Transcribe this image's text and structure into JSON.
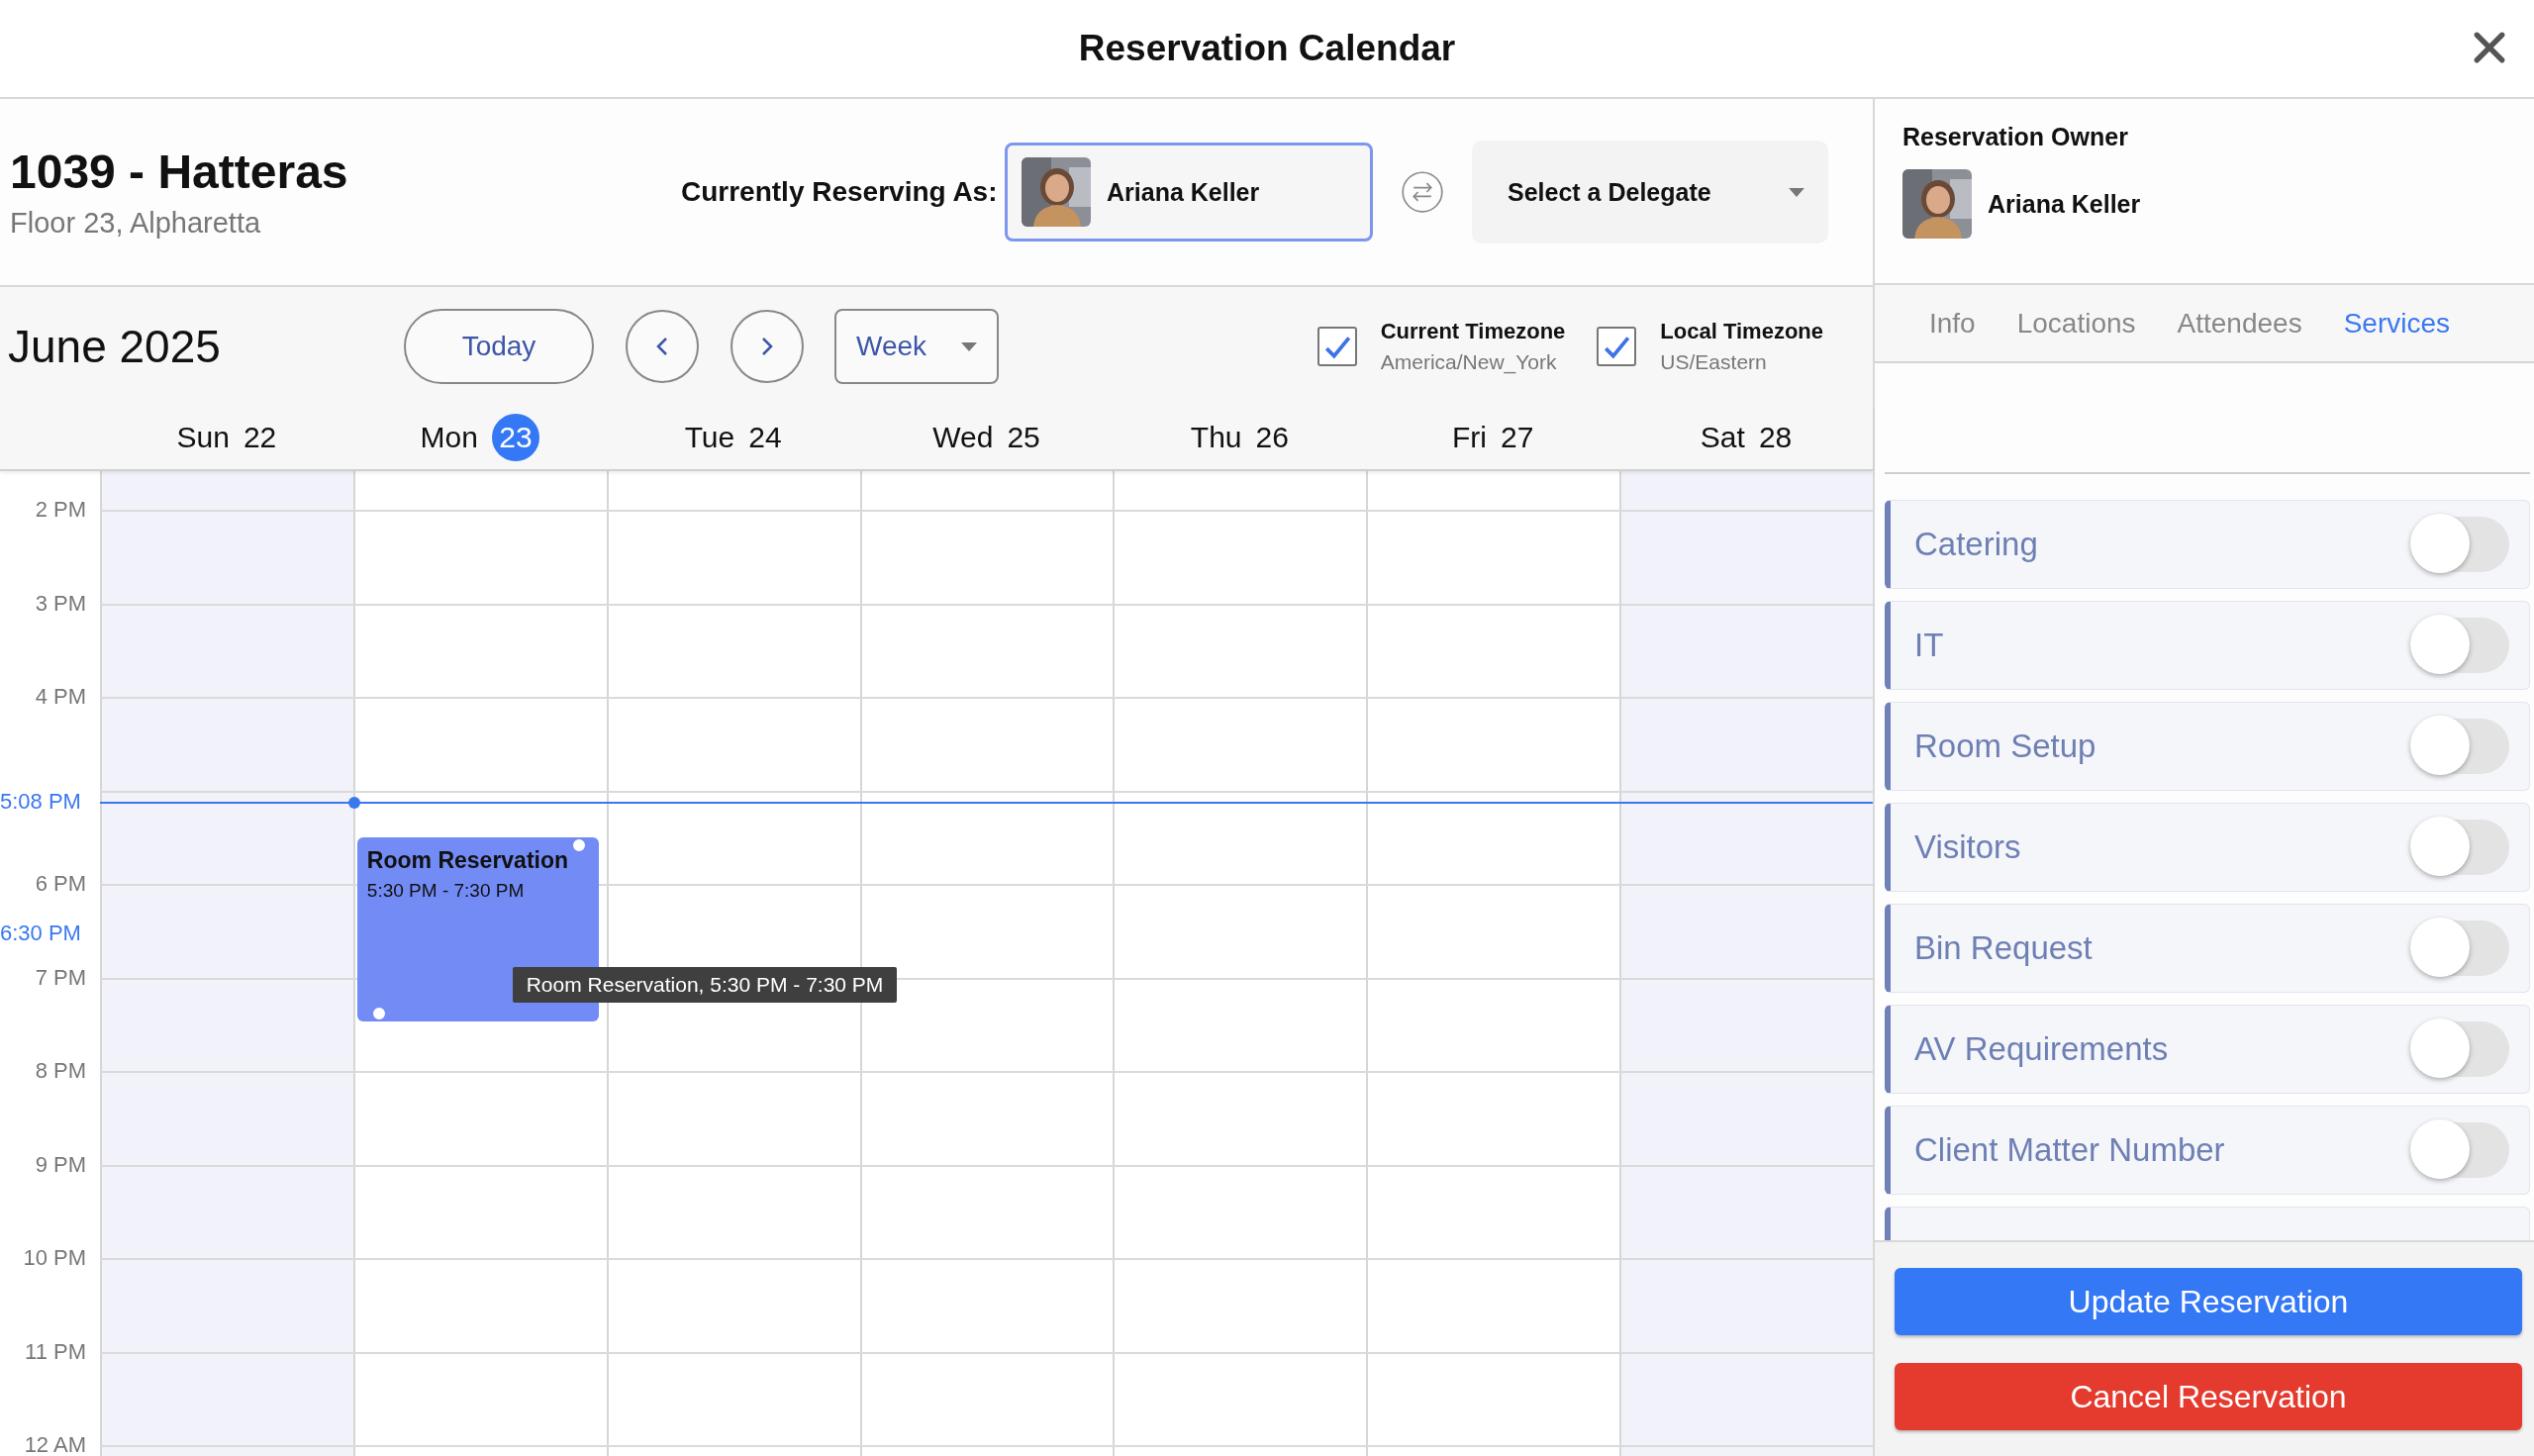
{
  "window": {
    "title": "Reservation Calendar"
  },
  "room": {
    "title": "1039 - Hatteras",
    "subtitle": "Floor 23, Alpharetta"
  },
  "reserving_as": {
    "label": "Currently Reserving As:",
    "name": "Ariana Keller"
  },
  "delegate": {
    "placeholder": "Select a Delegate"
  },
  "toolbar": {
    "month": "June 2025",
    "today": "Today",
    "view": "Week"
  },
  "timezones": [
    {
      "title": "Current Timezone",
      "zone": "America/New_York",
      "checked": true
    },
    {
      "title": "Local Timezone",
      "zone": "US/Eastern",
      "checked": true
    }
  ],
  "days": [
    {
      "name": "Sun",
      "date": "22",
      "today": false,
      "weekend": true
    },
    {
      "name": "Mon",
      "date": "23",
      "today": true,
      "weekend": false,
      "events": [
        {
          "title": "Room Reservation",
          "time": "5:30 PM - 7:30 PM",
          "tooltip": "Room Reservation, 5:30 PM - 7:30 PM"
        }
      ]
    },
    {
      "name": "Tue",
      "date": "24",
      "today": false,
      "weekend": false
    },
    {
      "name": "Wed",
      "date": "25",
      "today": false,
      "weekend": false
    },
    {
      "name": "Thu",
      "date": "26",
      "today": false,
      "weekend": false
    },
    {
      "name": "Fri",
      "date": "27",
      "today": false,
      "weekend": false
    },
    {
      "name": "Sat",
      "date": "28",
      "today": false,
      "weekend": true
    }
  ],
  "hours": [
    {
      "kind": "labeled",
      "label": "2 PM"
    },
    {
      "kind": "labeled",
      "label": "3 PM"
    },
    {
      "kind": "labeled",
      "label": "4 PM"
    },
    {
      "kind": "covered"
    },
    {
      "kind": "labeled",
      "label": "6 PM"
    },
    {
      "kind": "labeled",
      "label": "7 PM"
    },
    {
      "kind": "labeled",
      "label": "8 PM"
    },
    {
      "kind": "labeled",
      "label": "9 PM"
    },
    {
      "kind": "labeled",
      "label": "10 PM"
    },
    {
      "kind": "labeled",
      "label": "11 PM"
    },
    {
      "kind": "labeled",
      "label": "12 AM"
    }
  ],
  "now_marker": {
    "label": "5:08 PM"
  },
  "hover_marker": {
    "label": "6:30 PM"
  },
  "owner": {
    "heading": "Reservation Owner",
    "name": "Ariana Keller"
  },
  "tabs": [
    {
      "label": "Info",
      "selected": false
    },
    {
      "label": "Locations",
      "selected": false
    },
    {
      "label": "Attendees",
      "selected": false
    },
    {
      "label": "Services",
      "selected": true
    }
  ],
  "services": [
    {
      "label": "Catering",
      "on": false
    },
    {
      "label": "IT",
      "on": false
    },
    {
      "label": "Room Setup",
      "on": false
    },
    {
      "label": "Visitors",
      "on": false
    },
    {
      "label": "Bin Request",
      "on": false
    },
    {
      "label": "AV Requirements",
      "on": false
    },
    {
      "label": "Client Matter Number",
      "on": false
    }
  ],
  "buttons": [
    {
      "label": "Update Reservation",
      "kind": "primary"
    },
    {
      "label": "Cancel Reservation",
      "kind": "danger"
    }
  ]
}
